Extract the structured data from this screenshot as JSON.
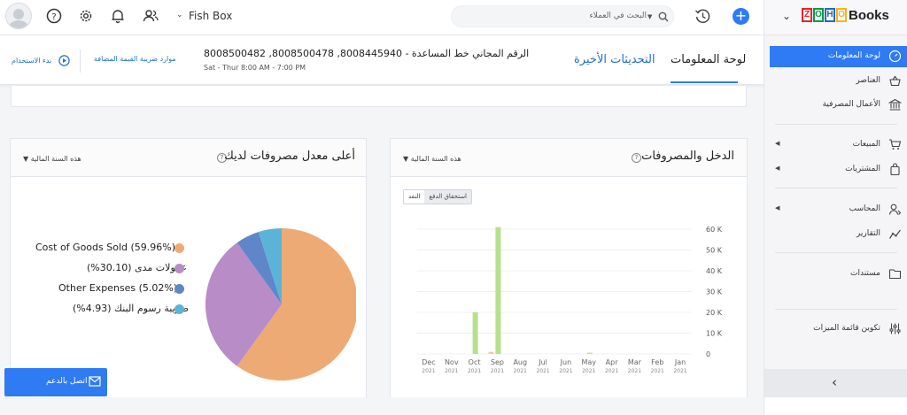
{
  "org": {
    "name": "Fish Box"
  },
  "search": {
    "placeholder": "البحث في العملاء"
  },
  "brand": {
    "name": "Books",
    "logo_letters": [
      "Z",
      "O",
      "H",
      "O"
    ],
    "logo_colors": [
      "#e42527",
      "#089949",
      "#226db4",
      "#f9b21d"
    ]
  },
  "sidebar": {
    "items": [
      {
        "label": "لوحة المعلومات",
        "icon": "dashboard-icon",
        "active": true
      },
      {
        "label": "العناصر",
        "icon": "basket-icon"
      },
      {
        "label": "الأعمال المصرفية",
        "icon": "bank-icon"
      },
      {
        "label": "المبيعات",
        "icon": "cart-icon",
        "expandable": true
      },
      {
        "label": "المشتريات",
        "icon": "bag-icon",
        "expandable": true
      },
      {
        "label": "المحاسب",
        "icon": "accountant-icon",
        "expandable": true
      },
      {
        "label": "التقارير",
        "icon": "reports-icon"
      },
      {
        "label": "مستندات",
        "icon": "folder-icon"
      },
      {
        "label": "تكوين قائمة الميزات",
        "icon": "sliders-icon"
      }
    ],
    "collapse": "‹"
  },
  "tabs": {
    "dashboard": "لوحة المعلومات",
    "updates": "التحديثات الأخيرة"
  },
  "helpline": {
    "line1": "8008500482 ,8008500478 ,8008445940 - الرقم المجاني خط المساعدة",
    "line2": "Sat - Thur 8:00 AM - 7:00 PM"
  },
  "links": {
    "vat": "موارد ضريبة القيمة المضافة",
    "start": "بدء الاستخدام"
  },
  "income_panel": {
    "title": "الدخل والمصروفات",
    "period": "هذه السنة المالية",
    "toggle": [
      "استحقاق الدفع",
      "النقد"
    ]
  },
  "expense_panel": {
    "title": "أعلى معدل مصروفات لديك",
    "period": "هذه السنة المالية"
  },
  "contact": {
    "label": "اتصل بالدعم"
  },
  "chart_data": [
    {
      "type": "bar",
      "categories": [
        "Dec",
        "Nov",
        "Oct",
        "Sep",
        "Aug",
        "Jul",
        "Jun",
        "May",
        "Apr",
        "Mar",
        "Feb",
        "Jan"
      ],
      "category_sublabel": "2021",
      "series": [
        {
          "values": [
            0,
            0,
            20,
            61,
            0,
            0,
            0,
            0.6,
            0,
            0,
            0,
            0
          ],
          "color": "#b7e08e"
        },
        {
          "values": [
            0,
            0,
            0,
            1.0,
            0,
            0,
            0,
            0,
            0,
            0,
            0,
            0
          ],
          "color": "#e8d29a"
        }
      ],
      "yticks": [
        "0",
        "10 K",
        "20 K",
        "30 K",
        "40 K",
        "50 K",
        "60 K"
      ],
      "ylim": [
        0,
        60
      ],
      "grid": true
    },
    {
      "type": "pie",
      "labels": [
        "Cost of Goods Sold (59.96%)",
        "عمولات مدى (30.10%)",
        "Other Expenses (5.02%)",
        "ضريبة رسوم البنك (4.93%)"
      ],
      "values": [
        59.96,
        30.1,
        5.02,
        4.93
      ],
      "colors": [
        "#eeaa74",
        "#b88cc6",
        "#5e86c8",
        "#5bb4d8"
      ]
    }
  ]
}
